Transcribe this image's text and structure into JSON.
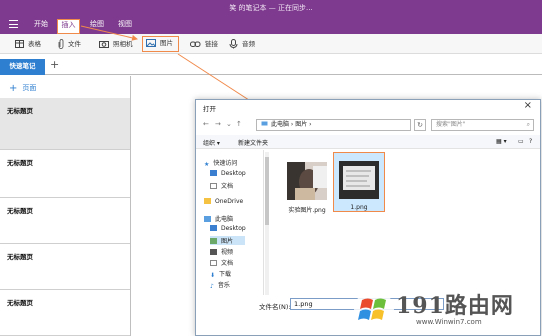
{
  "app": {
    "title": "笑 的笔记本 — 正在同步...",
    "accent": "#7e3a8e",
    "highlight": "#f08a4b"
  },
  "ribbon_tabs": [
    {
      "label": "开始"
    },
    {
      "label": "插入"
    },
    {
      "label": "绘图"
    },
    {
      "label": "视图"
    }
  ],
  "ribbon_commands": [
    {
      "label": "表格",
      "icon": "table-icon"
    },
    {
      "label": "文件",
      "icon": "paperclip-icon"
    },
    {
      "label": "照相机",
      "icon": "camera-icon"
    },
    {
      "label": "图片",
      "icon": "picture-icon"
    },
    {
      "label": "链接",
      "icon": "link-icon"
    },
    {
      "label": "音频",
      "icon": "microphone-icon"
    }
  ],
  "section": {
    "label": "快速笔记",
    "add": "+"
  },
  "pages": {
    "add_label": "页面",
    "items": [
      "无标题页",
      "无标题页",
      "无标题页",
      "无标题页",
      "无标题页"
    ]
  },
  "dialog": {
    "title": "打开",
    "close": "×",
    "address": "此电脑  ›  图片  ›",
    "search_placeholder": "搜索\"图片\"",
    "organize": "组织 ▾",
    "new_folder": "新建文件夹",
    "nav": [
      {
        "label": "快速访问",
        "icon": "star-icon"
      },
      {
        "label": "Desktop",
        "icon": "desktop-icon"
      },
      {
        "label": "文档",
        "icon": "document-icon"
      },
      {
        "label": "OneDrive",
        "icon": "folder-icon"
      },
      {
        "label": "此电脑",
        "icon": "computer-icon"
      },
      {
        "label": "Desktop",
        "icon": "desktop-icon"
      },
      {
        "label": "图片",
        "icon": "picture-folder-icon"
      },
      {
        "label": "视频",
        "icon": "video-icon"
      },
      {
        "label": "文档",
        "icon": "document-icon"
      },
      {
        "label": "下载",
        "icon": "download-icon"
      },
      {
        "label": "音乐",
        "icon": "music-icon"
      }
    ],
    "files": [
      {
        "name": "实验图片.png"
      },
      {
        "name": "1.png"
      }
    ],
    "filename_label": "文件名(N):",
    "filename_value": "1.png"
  },
  "watermark": {
    "brand": "191路由网",
    "url": "www.Winwin7.com"
  }
}
